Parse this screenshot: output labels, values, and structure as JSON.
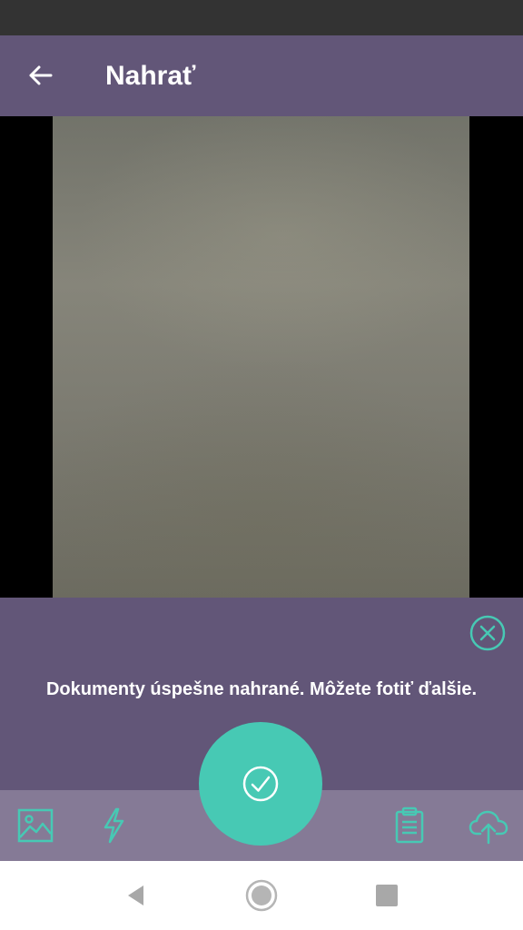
{
  "app_bar": {
    "title": "Nahrať",
    "back_icon": "arrow-left-icon"
  },
  "notification": {
    "message": "Dokumenty úspešne nahrané. Môžete fotiť ďalšie.",
    "close_icon": "close-circle-icon"
  },
  "toolbar": {
    "items": [
      {
        "name": "gallery",
        "icon": "image-icon"
      },
      {
        "name": "flash",
        "icon": "lightning-icon"
      },
      {
        "name": "clipboard",
        "icon": "clipboard-icon"
      },
      {
        "name": "cloud-upload",
        "icon": "cloud-upload-icon"
      }
    ],
    "capture_icon": "check-circle-icon"
  },
  "system_nav": {
    "items": [
      "back-triangle-icon",
      "home-circle-icon",
      "recents-square-icon"
    ]
  },
  "colors": {
    "status_bar": "#333333",
    "app_bar": "#625678",
    "toolbar": "#857a96",
    "accent": "#47c9b4",
    "camera_background": "#000000"
  }
}
